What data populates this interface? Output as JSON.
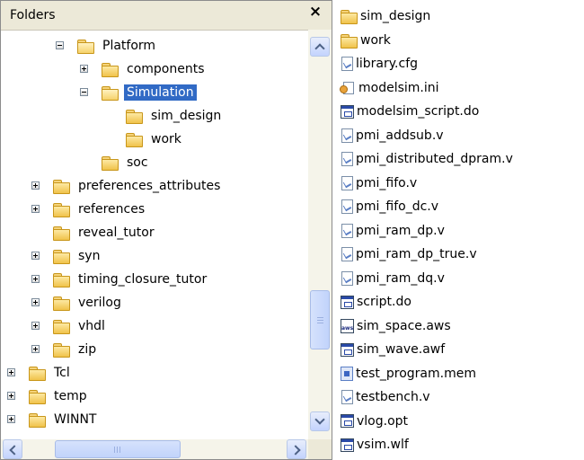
{
  "folders_pane": {
    "title": "Folders",
    "close_glyph": "×",
    "tree": [
      {
        "label": "Platform",
        "expander": "minus",
        "open": true
      },
      {
        "label": "components",
        "expander": "plus"
      },
      {
        "label": "Simulation",
        "expander": "minus",
        "open": true,
        "selected": true
      },
      {
        "label": "sim_design",
        "expander": "none"
      },
      {
        "label": "work",
        "expander": "none"
      },
      {
        "label": "soc",
        "expander": "none"
      },
      {
        "label": "preferences_attributes",
        "expander": "plus"
      },
      {
        "label": "references",
        "expander": "plus"
      },
      {
        "label": "reveal_tutor",
        "expander": "none"
      },
      {
        "label": "syn",
        "expander": "plus"
      },
      {
        "label": "timing_closure_tutor",
        "expander": "plus"
      },
      {
        "label": "verilog",
        "expander": "plus"
      },
      {
        "label": "vhdl",
        "expander": "plus"
      },
      {
        "label": "zip",
        "expander": "plus"
      },
      {
        "label": "Tcl",
        "expander": "plus"
      },
      {
        "label": "temp",
        "expander": "plus"
      },
      {
        "label": "WINNT",
        "expander": "plus"
      }
    ]
  },
  "file_list": [
    {
      "name": "sim_design",
      "icon": "folder-icon"
    },
    {
      "name": "work",
      "icon": "folder-icon"
    },
    {
      "name": "library.cfg",
      "icon": "document-icon"
    },
    {
      "name": "modelsim.ini",
      "icon": "config-file-icon"
    },
    {
      "name": "modelsim_script.do",
      "icon": "script-file-icon"
    },
    {
      "name": "pmi_addsub.v",
      "icon": "document-icon"
    },
    {
      "name": "pmi_distributed_dpram.v",
      "icon": "document-icon"
    },
    {
      "name": "pmi_fifo.v",
      "icon": "document-icon"
    },
    {
      "name": "pmi_fifo_dc.v",
      "icon": "document-icon"
    },
    {
      "name": "pmi_ram_dp.v",
      "icon": "document-icon"
    },
    {
      "name": "pmi_ram_dp_true.v",
      "icon": "document-icon"
    },
    {
      "name": "pmi_ram_dq.v",
      "icon": "document-icon"
    },
    {
      "name": "script.do",
      "icon": "script-file-icon"
    },
    {
      "name": "sim_space.aws",
      "icon": "aws-file-icon"
    },
    {
      "name": "sim_wave.awf",
      "icon": "script-file-icon"
    },
    {
      "name": "test_program.mem",
      "icon": "memory-file-icon"
    },
    {
      "name": "testbench.v",
      "icon": "document-icon"
    },
    {
      "name": "vlog.opt",
      "icon": "script-file-icon"
    },
    {
      "name": "vsim.wlf",
      "icon": "script-file-icon"
    }
  ],
  "colors": {
    "selection": "#316ac5",
    "folder": "#f0c24a",
    "pane_header": "#ece9d8"
  }
}
